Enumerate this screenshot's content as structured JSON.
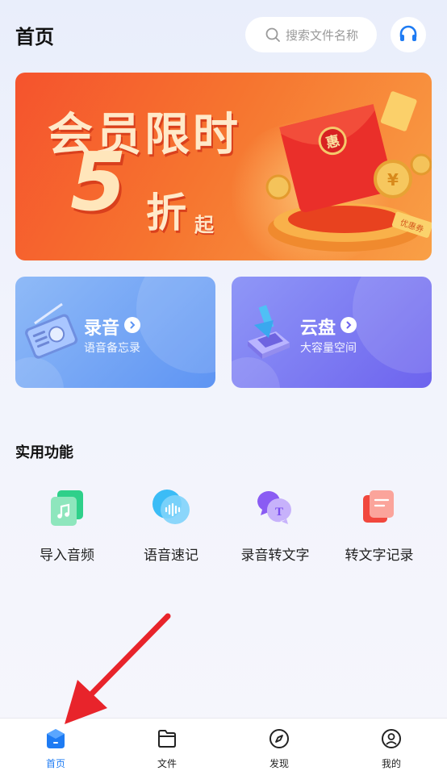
{
  "header": {
    "title": "首页",
    "search_placeholder": "搜索文件名称"
  },
  "banner": {
    "line1": "会员限时",
    "discount_number": "5",
    "discount_unit": "折",
    "discount_suffix": "起",
    "envelope_char": "惠",
    "coupon_text": "优惠券"
  },
  "cards": [
    {
      "title": "录音",
      "subtitle": "语音备忘录"
    },
    {
      "title": "云盘",
      "subtitle": "大容量空间"
    }
  ],
  "tools_section": {
    "title": "实用功能",
    "items": [
      {
        "label": "导入音频",
        "icon": "music-file-icon"
      },
      {
        "label": "语音速记",
        "icon": "waveform-icon"
      },
      {
        "label": "录音转文字",
        "icon": "chat-text-icon"
      },
      {
        "label": "转文字记录",
        "icon": "document-list-icon"
      }
    ]
  },
  "tabbar": {
    "items": [
      {
        "label": "首页",
        "active": true
      },
      {
        "label": "文件",
        "active": false
      },
      {
        "label": "发现",
        "active": false
      },
      {
        "label": "我的",
        "active": false
      }
    ]
  },
  "colors": {
    "accent": "#1e7bf3",
    "banner_start": "#f5532d",
    "banner_end": "#f9a046",
    "annotation_arrow": "#e8242b"
  }
}
